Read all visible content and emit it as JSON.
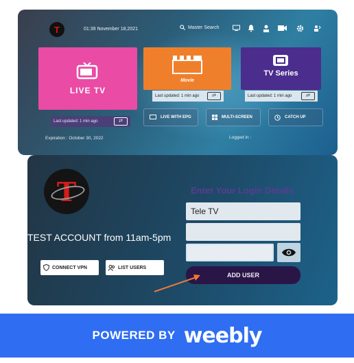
{
  "dashboard": {
    "datetime": "01:39 November 18,2021",
    "search_label": "Master Search",
    "tiles": {
      "live": {
        "label": "LIVE TV",
        "updated": "Last updated: 1 min ago"
      },
      "movie": {
        "label": "Movie",
        "updated": "Last updated: 1 min ago"
      },
      "series": {
        "label": "TV Series",
        "updated": "Last updated: 1 min ago"
      }
    },
    "pills": [
      "LIVE WITH EPG",
      "MULTI-SCREEN",
      "CATCH UP"
    ],
    "expiration": "Expiration : October 30, 2022",
    "logged_in": "Logged in :",
    "icons": [
      "monitor-icon",
      "bell-icon",
      "user-icon",
      "camera-icon",
      "gear-icon",
      "switch-user-icon"
    ]
  },
  "login": {
    "heading": "Enter Your Login Details",
    "username_value": "Tele TV",
    "password_value": "",
    "add_user_label": "ADD USER",
    "account_text": "TEST ACCOUNT from 11am-5pm",
    "connect_vpn_label": "CONNECT VPN",
    "list_users_label": "LIST USERS"
  },
  "banner": {
    "prefix": "POWERED BY",
    "brand": "weebly"
  },
  "colors": {
    "live": "#e94ba5",
    "movie": "#f07f2b",
    "series": "#4b2d8d",
    "banner": "#2f6ef2",
    "add_user": "#2a1547",
    "heading": "#5a3c92"
  }
}
